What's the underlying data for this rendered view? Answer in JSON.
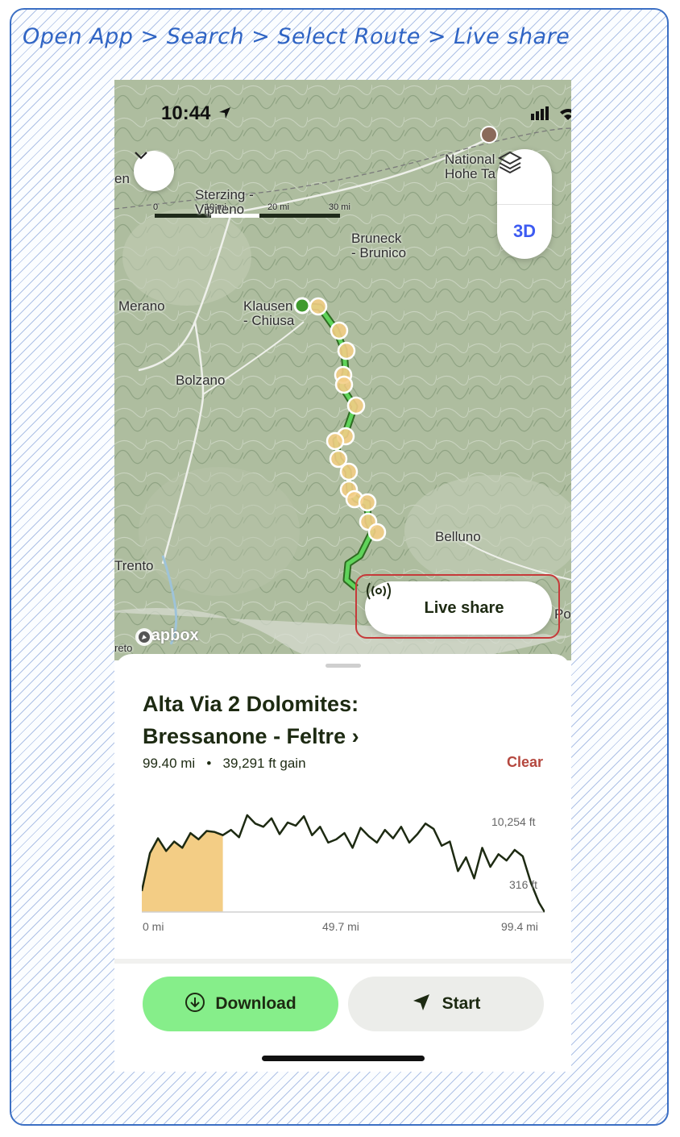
{
  "caption": "Open App > Search > Select Route > Live share",
  "status_bar": {
    "time": "10:44"
  },
  "map": {
    "scale_labels": [
      "0",
      "10 mi",
      "20 mi",
      "30 mi"
    ],
    "places": {
      "sterzing": "Sterzing -\nVipiteno",
      "national_park": "National\nHohe Ta",
      "bruneck": "Bruneck\n- Brunico",
      "merano": "Merano",
      "klausen": "Klausen\n- Chiusa",
      "bolzano": "Bolzano",
      "belluno": "Belluno",
      "trento": "Trento",
      "edge_left_top": "en",
      "edge_left_bottom": "reto",
      "edge_right": "Po"
    },
    "attribution": "mapbox",
    "toggle_3d": "3D",
    "live_share_label": "Live share"
  },
  "route": {
    "title": "Alta Via 2 Dolomites: Bressanone - Feltre",
    "title_chevron": "›",
    "distance": "99.40 mi",
    "separator": "•",
    "gain": "39,291 ft gain",
    "clear_label": "Clear",
    "elevation": {
      "max_label": "10,254 ft",
      "min_label": "316 ft",
      "x_labels": [
        "0 mi",
        "49.7 mi",
        "99.4 mi"
      ]
    }
  },
  "chart_data": {
    "type": "area",
    "x_unit": "mi",
    "y_unit": "ft",
    "xlim": [
      0,
      99.4
    ],
    "ylim": [
      316,
      10254
    ],
    "highlight_range_mi": [
      0,
      20
    ],
    "profile_mi": [
      0,
      2,
      4,
      6,
      8,
      10,
      12,
      14,
      16,
      18,
      20,
      22,
      24,
      26,
      28,
      30,
      32,
      34,
      36,
      38,
      40,
      42,
      44,
      46,
      48,
      50,
      52,
      54,
      56,
      58,
      60,
      62,
      64,
      66,
      68,
      70,
      72,
      74,
      76,
      78,
      80,
      82,
      84,
      86,
      88,
      90,
      92,
      94,
      96,
      98,
      99.4
    ],
    "profile_ft": [
      2300,
      5900,
      7300,
      6100,
      7000,
      6400,
      7800,
      7200,
      8000,
      7900,
      7600,
      8100,
      7400,
      9500,
      8700,
      8400,
      9200,
      7700,
      8800,
      8500,
      9400,
      7600,
      8400,
      6900,
      7200,
      7800,
      6400,
      8300,
      7500,
      6900,
      8100,
      7300,
      8400,
      6900,
      7700,
      8700,
      8200,
      6600,
      7000,
      4200,
      5500,
      3500,
      6400,
      4600,
      5800,
      5200,
      6200,
      5600,
      3100,
      1200,
      316
    ]
  },
  "actions": {
    "download": "Download",
    "start": "Start"
  },
  "colors": {
    "route_line": "#5fd35a",
    "highlight_fill": "#f3cd85",
    "download_bg": "#86ee8a",
    "start_bg": "#ecedea",
    "clear_text": "#b5483f",
    "accent_3d": "#3d5bf2",
    "annotation_red": "#c63a3a"
  },
  "icons": {
    "collapse": "chevron-down-icon",
    "layers": "layers-icon",
    "live_share": "broadcast-icon",
    "download": "download-circle-icon",
    "start": "navigation-arrow-icon",
    "location": "location-arrow-icon"
  }
}
